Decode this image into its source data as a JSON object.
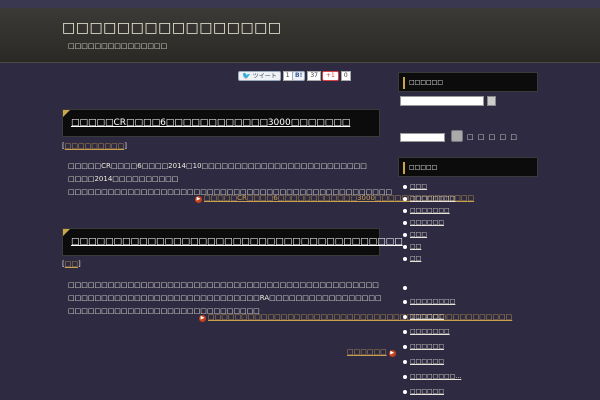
{
  "header": {
    "site_title": "□□□□□□□□□□□□□□□□",
    "site_description": "□□□□□□□□□□□□□□□"
  },
  "social": {
    "tweet_label": "ツイート",
    "tweet_count": "1",
    "share_count": "37",
    "gplus_label": "+1",
    "gplus_count": "0"
  },
  "posts": [
    {
      "title": "□□□□□CR□□□□6□□□□□□□□□□□□3000□□□□□□□",
      "category": "□□□□□□□□□",
      "excerpt": "□□□□□CR□□□□6□□□□2014□10□□□□□□□□□□□□□□□□□□□□□□□□□ □□□□2014□□□□□□□□□□ □□□□□□□□□□□□□□□□□□□□□□□□□□□□□□□□□□□□□□□□□□□□□□□□□",
      "read_more": "□□□□□CR□□□□6□□□□□□□□□□□□3000□□□□□□□□□□□□□□□"
    },
    {
      "title": "□□□□□□□□□□□□□□□□□□□□□□□□□□□□□□□□□□□□□□□",
      "category": "□□",
      "excerpt": "□□□□□□□□□□□□□□□□□□□□□□□□□□□□□□□□□□□□□□□□□□□□□□□ □□□□□□□□□□□□□□□□□□□□□□□□□□□□□RA□□□□□□□□□□□□□□□□□ □□□□□□□□□□□□□□□□□□□□□□□□□□□□□",
      "read_more": "□□□□□□□□□□□□□□□□□□□□□□□□□□□□□□□□□□□□□□□□□□□□□□"
    }
  ],
  "pagination": {
    "next_label": "□□□□□□"
  },
  "sidebar": {
    "search_heading": "□□□□□□",
    "search_label": "□ □ □ □ □",
    "links_heading": "□□□□□",
    "links": [
      "□□□",
      "□□□□□□□□",
      "□□□□□□□",
      "□□□□□□",
      "□□□",
      "□□",
      "□□"
    ],
    "recent": [
      "□□□□□□□□",
      "□□□□□□",
      "□□□□□□□",
      "□□□□□□",
      "□□□□□□",
      "□□□□□□□□…",
      "□□□□□□"
    ]
  }
}
